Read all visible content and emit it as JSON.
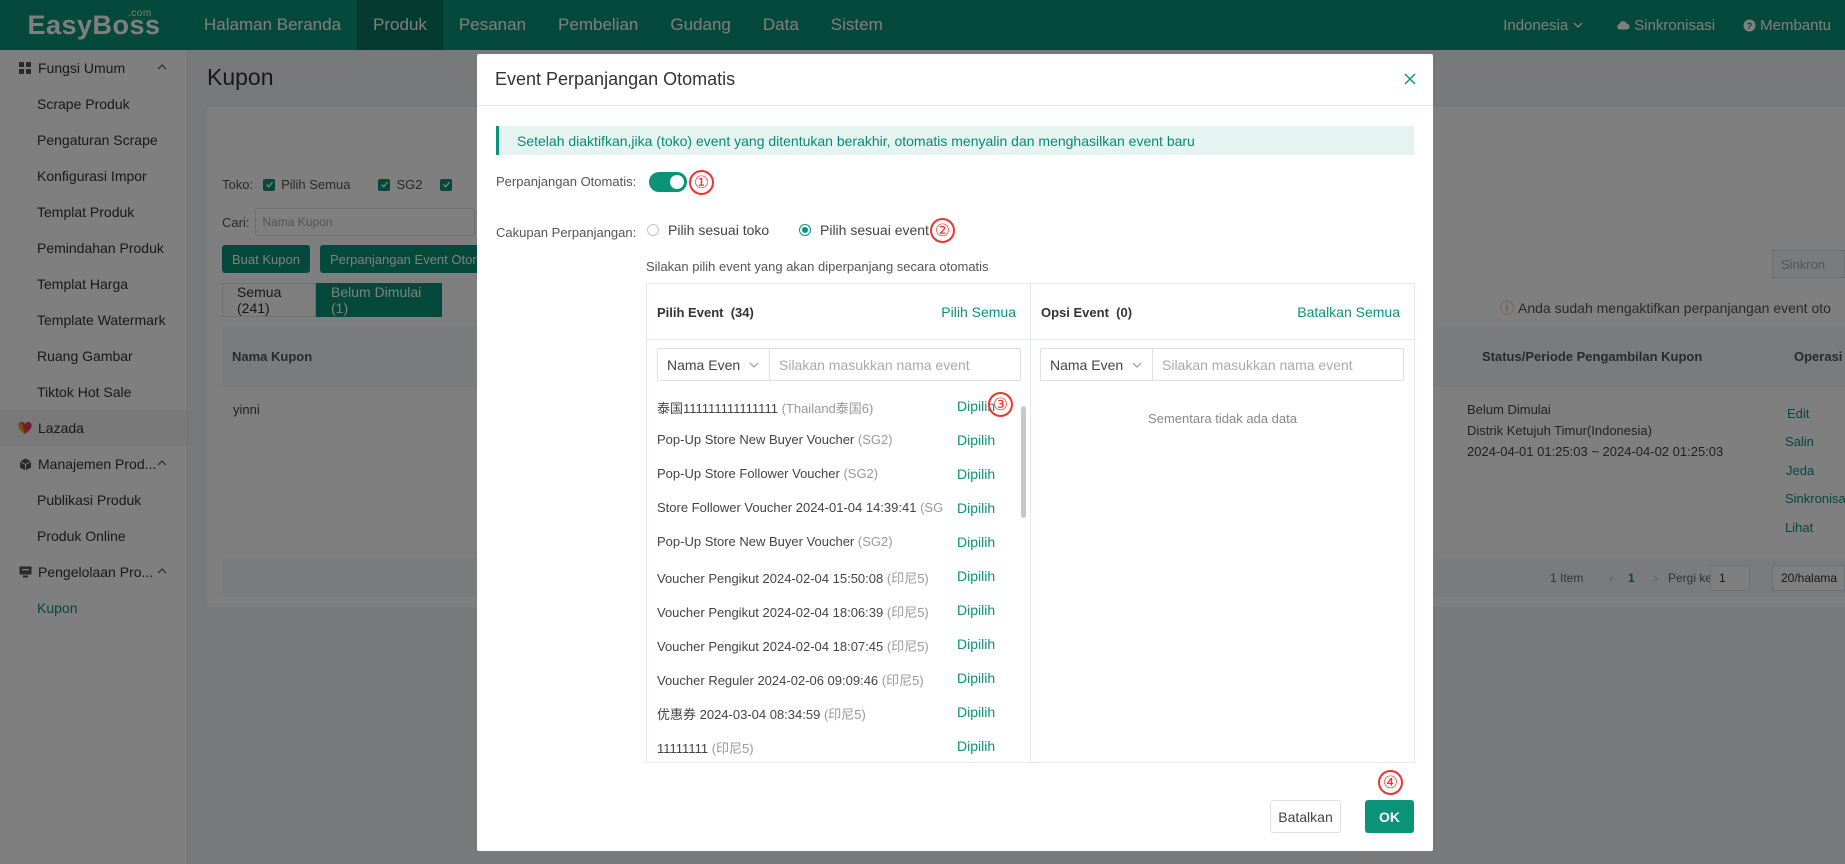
{
  "app": {
    "logo": "EasyBoss",
    "logo_suffix": ".com"
  },
  "topnav": {
    "items": [
      "Halaman Beranda",
      "Produk",
      "Pesanan",
      "Pembelian",
      "Gudang",
      "Data",
      "Sistem"
    ],
    "active": "Produk",
    "region": "Indonesia",
    "sync": "Sinkronisasi",
    "help": "Membantu"
  },
  "sidebar": {
    "group1": "Fungsi Umum",
    "group1_items": [
      "Scrape Produk",
      "Pengaturan Scrape",
      "Konfigurasi Impor",
      "Templat Produk",
      "Pemindahan Produk",
      "Templat Harga",
      "Template Watermark",
      "Ruang Gambar",
      "Tiktok Hot Sale"
    ],
    "lazada": "Lazada",
    "group2": "Manajemen Prod...",
    "group2_items": [
      "Publikasi Produk",
      "Produk Online"
    ],
    "group3": "Pengelolaan Pro...",
    "group3_items": [
      "Kupon"
    ]
  },
  "page": {
    "title": "Kupon",
    "toko_label": "Toko:",
    "select_all": "Pilih Semua",
    "shop_sg2": "SG2",
    "search_label": "Cari:",
    "search_placeholder": "Nama Kupon",
    "btn_create": "Buat Kupon",
    "btn_extend": "Perpanjangan Event Otom",
    "btn_sync": "Sinkron",
    "tab_all": "Semua (241)",
    "tab_not_started": "Belum Dimulai (1)",
    "note": "Anda sudah mengaktifkan perpanjangan event oto",
    "col_name": "Nama Kupon",
    "col_status": "Status/Periode Pengambilan Kupon",
    "col_ops": "Operasi",
    "row": {
      "name": "yinni",
      "status": "Belum Dimulai",
      "region": "Distrik Ketujuh Timur(Indonesia)",
      "period": "2024-04-01 01:25:03 ~ 2024-04-02 01:25:03",
      "ops": [
        "Edit",
        "Salin",
        "Jeda",
        "Sinkronisa",
        "Lihat"
      ]
    },
    "pager": {
      "count": "1 Item",
      "current": "1",
      "goto_label": "Pergi ke",
      "goto_value": "1",
      "page_size": "20/halama"
    }
  },
  "modal": {
    "title": "Event Perpanjangan Otomatis",
    "alert": "Setelah diaktifkan,jika (toko) event yang ditentukan berakhir, otomatis menyalin dan menghasilkan event baru",
    "auto_label": "Perpanjangan Otomatis:",
    "auto_enabled": true,
    "scope_label": "Cakupan Perpanjangan:",
    "scope_options": [
      "Pilih sesuai toko",
      "Pilih sesuai event"
    ],
    "scope_selected": "Pilih sesuai event",
    "hint": "Silakan pilih event yang akan diperpanjang secara otomatis",
    "left_title": "Pilih Event",
    "left_count": "(34)",
    "left_action": "Pilih Semua",
    "right_title": "Opsi Event",
    "right_count": "(0)",
    "right_action": "Batalkan Semua",
    "filter_select": "Nama Even",
    "filter_placeholder": "Silakan masukkan nama event",
    "empty_text": "Sementara tidak ada data",
    "pick_label": "Dipilih",
    "events": [
      {
        "name": "泰国111111111111111",
        "shop": "(Thailand泰国6)"
      },
      {
        "name": "Pop-Up Store New Buyer Voucher",
        "shop": "(SG2)"
      },
      {
        "name": "Pop-Up Store Follower Voucher",
        "shop": "(SG2)"
      },
      {
        "name": "Store Follower Voucher 2024-01-04 14:39:41",
        "shop": "(SG"
      },
      {
        "name": "Pop-Up Store New Buyer Voucher",
        "shop": "(SG2)"
      },
      {
        "name": "Voucher Pengikut 2024-02-04 15:50:08",
        "shop": "(印尼5)"
      },
      {
        "name": "Voucher Pengikut 2024-02-04 18:06:39",
        "shop": "(印尼5)"
      },
      {
        "name": "Voucher Pengikut 2024-02-04 18:07:45",
        "shop": "(印尼5)"
      },
      {
        "name": "Voucher Reguler 2024-02-06 09:09:46",
        "shop": "(印尼5)"
      },
      {
        "name": "优惠券 2024-03-04 08:34:59",
        "shop": "(印尼5)"
      },
      {
        "name": "11111111",
        "shop": "(印尼5)"
      }
    ],
    "btn_cancel": "Batalkan",
    "btn_ok": "OK",
    "markers": [
      "①",
      "②",
      "③",
      "④"
    ]
  },
  "colors": {
    "brand": "#0a9378",
    "marker": "#e33333"
  }
}
